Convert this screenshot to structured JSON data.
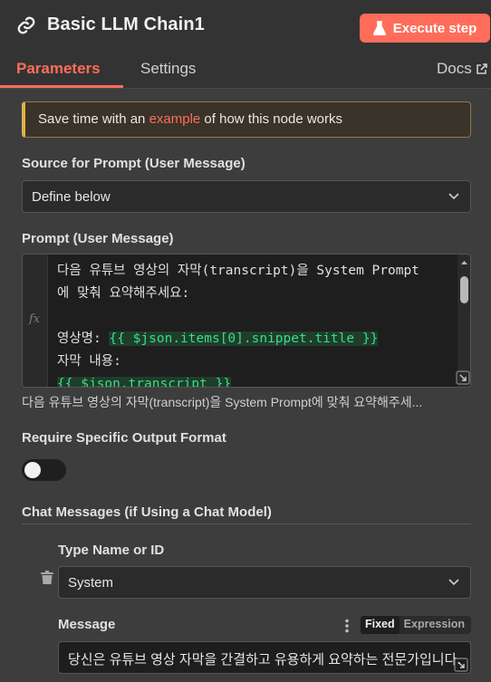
{
  "header": {
    "title": "Basic LLM Chain1",
    "execute_label": "Execute step"
  },
  "tabs": {
    "parameters": "Parameters",
    "settings": "Settings",
    "docs": "Docs"
  },
  "hint": {
    "prefix": "Save time with an ",
    "link": "example",
    "suffix": " of how this node works"
  },
  "source_prompt": {
    "label": "Source for Prompt (User Message)",
    "value": "Define below"
  },
  "prompt": {
    "label": "Prompt (User Message)",
    "gutter_icon": "fx",
    "lines": {
      "l1": "다음 유튜브 영상의 자막(transcript)을 System Prompt",
      "l2": "에 맞춰 요약해주세요:",
      "l4_prefix": "영상명: ",
      "l4_expr": "{{ $json.items[0].snippet.title }}",
      "l5": "자막 내용:",
      "l6_expr": "{{ $json.transcript }}"
    },
    "preview": "다음 유튜브 영상의 자막(transcript)을 System Prompt에 맞춰 요약해주세..."
  },
  "output_format": {
    "label": "Require Specific Output Format",
    "enabled": false
  },
  "chat_messages": {
    "label": "Chat Messages (if Using a Chat Model)",
    "type_label": "Type Name or ID",
    "type_value": "System",
    "message_label": "Message",
    "mode_fixed": "Fixed",
    "mode_expression": "Expression",
    "message_value": "당신은 유튜브 영상 자막을 간결하고 유용하게 요약하는 전문가입니다."
  },
  "colors": {
    "accent": "#ff6d5a",
    "background": "#3d3d3d",
    "expression": "#3ddc84"
  },
  "icons": [
    "link-icon",
    "flask-icon",
    "external-link-icon",
    "chevron-down-icon",
    "fx-icon",
    "resize-icon",
    "trash-icon",
    "more-vertical-icon"
  ]
}
